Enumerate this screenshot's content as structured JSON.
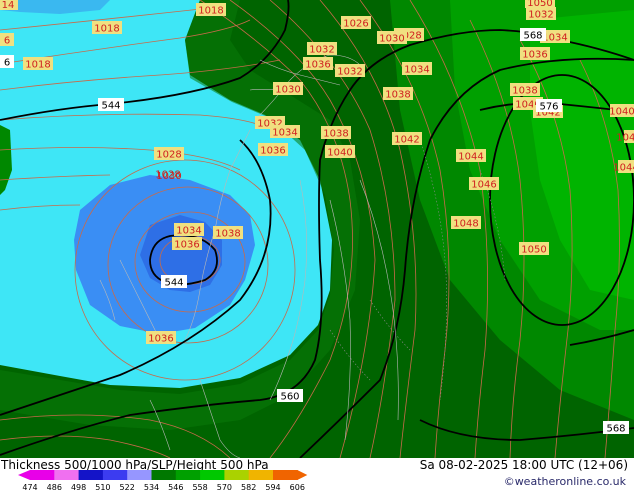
{
  "footer": {
    "title": "Thickness 500/1000 hPa/SLP/Height 500 hPa",
    "datetime": "Sa 08-02-2025 18:00 UTC (12+06)",
    "credit": "©weatheronline.co.uk"
  },
  "legend": {
    "values": [
      "474",
      "486",
      "498",
      "510",
      "522",
      "534",
      "546",
      "558",
      "570",
      "582",
      "594",
      "606"
    ],
    "colors": [
      "#e800e8",
      "#f070f0",
      "#1414c8",
      "#3c3cf0",
      "#9696ff",
      "#007800",
      "#00a000",
      "#00c800",
      "#aad200",
      "#f0b400",
      "#f06400"
    ]
  },
  "map_labels": {
    "slp": [
      "1018",
      "1018",
      "1018",
      "1026",
      "1028",
      "1030",
      "1032",
      "1034",
      "1036",
      "1036",
      "1038",
      "1050",
      "1032",
      "1034",
      "1036",
      "1030",
      "1032",
      "1028",
      "1032",
      "1034",
      "1036",
      "1038",
      "1040",
      "1042",
      "1038",
      "1040",
      "1042",
      "1028",
      "1030",
      "1034",
      "1036",
      "1038",
      "1036",
      "1044",
      "1046",
      "1048",
      "1050",
      "1040",
      "1044",
      "1040"
    ],
    "height": [
      "544",
      "544",
      "560",
      "568",
      "568",
      "576"
    ],
    "edge": [
      "14",
      "6",
      "6"
    ]
  }
}
